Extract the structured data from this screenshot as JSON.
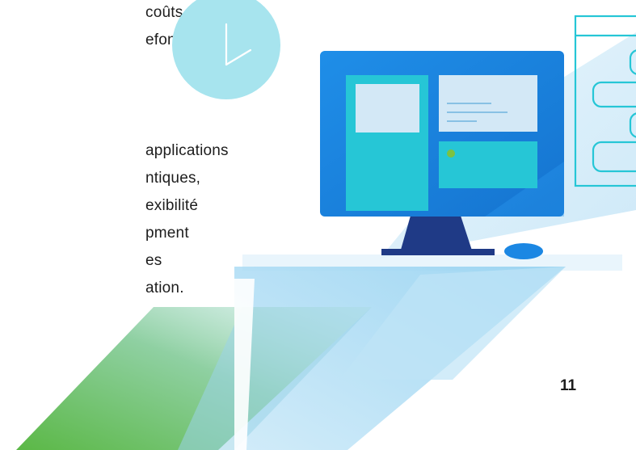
{
  "paragraph_1": {
    "lines": [
      "coûts",
      "efonte pour"
    ]
  },
  "paragraph_2": {
    "lines": [
      "applications",
      "ntiques,",
      "exibilité",
      "pment",
      "es",
      "ation."
    ]
  },
  "page_number": "11",
  "colors": {
    "monitor_frame": "#1b87e3",
    "monitor_stand": "#1f3a86",
    "panel_teal": "#26c6d6",
    "panel_light": "#d3e8f6",
    "clock": "#a7e4ee",
    "accent_green": "#7cc242",
    "ribbon_light_blue": "#aedbf4",
    "ribbon_green": "#5bb846"
  },
  "icons": {
    "clock": "clock-icon",
    "desktop": "desktop-monitor-icon",
    "mouse": "mouse-icon",
    "ui_panel": "ui-panel-icon"
  }
}
